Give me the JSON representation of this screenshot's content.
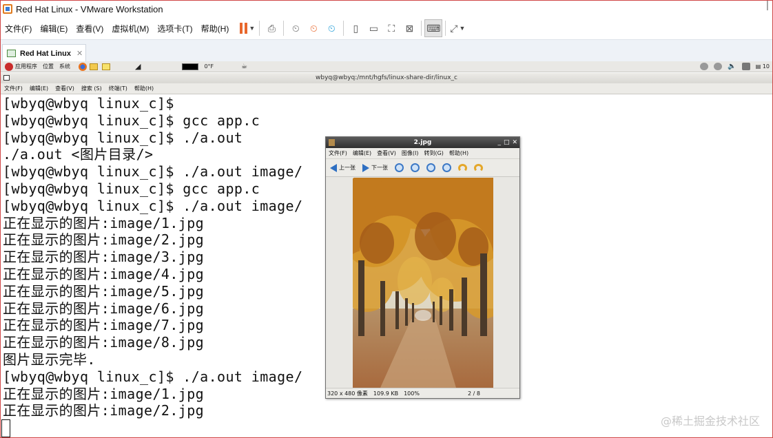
{
  "app": {
    "title": "Red Hat Linux - VMware Workstation",
    "menu": [
      "文件(F)",
      "编辑(E)",
      "查看(V)",
      "虚拟机(M)",
      "选项卡(T)",
      "帮助(H)"
    ],
    "toolbar_icons": [
      "pause-icon",
      "send-keys-icon",
      "snapshot-icon",
      "revert-snapshot-icon",
      "manage-snapshots-icon",
      "library-icon",
      "thumbnail-icon",
      "fit-guest-icon",
      "unity-icon",
      "console-icon",
      "fullscreen-icon"
    ],
    "accent_color": "#e8672c"
  },
  "tab": {
    "label": "Red Hat Linux",
    "close": "✕"
  },
  "guest_panel": {
    "items": [
      "应用程序",
      "位置",
      "系统"
    ],
    "temperature": "0°F",
    "clock": "10"
  },
  "terminal": {
    "title": "wbyq@wbyq:/mnt/hgfs/linux-share-dir/linux_c",
    "menu": [
      "文件(F)",
      "编辑(E)",
      "查看(V)",
      "搜索 (S)",
      "终端(T)",
      "帮助(H)"
    ],
    "lines": [
      "[wbyq@wbyq linux_c]$",
      "[wbyq@wbyq linux_c]$ gcc app.c",
      "[wbyq@wbyq linux_c]$ ./a.out",
      "./a.out <图片目录/>",
      "[wbyq@wbyq linux_c]$ ./a.out image/",
      "[wbyq@wbyq linux_c]$ gcc app.c",
      "[wbyq@wbyq linux_c]$ ./a.out image/",
      "正在显示的图片:image/1.jpg",
      "正在显示的图片:image/2.jpg",
      "正在显示的图片:image/3.jpg",
      "正在显示的图片:image/4.jpg",
      "正在显示的图片:image/5.jpg",
      "正在显示的图片:image/6.jpg",
      "正在显示的图片:image/7.jpg",
      "正在显示的图片:image/8.jpg",
      "图片显示完毕.",
      "[wbyq@wbyq linux_c]$ ./a.out image/",
      "正在显示的图片:image/1.jpg",
      "正在显示的图片:image/2.jpg"
    ]
  },
  "viewer": {
    "title": "2.jpg",
    "menu": [
      "文件(F)",
      "编辑(E)",
      "查看(V)",
      "图像(I)",
      "转到(G)",
      "帮助(H)"
    ],
    "prev_label": "上一张",
    "next_label": "下一张",
    "status": {
      "dimensions": "320 x 480 像素",
      "filesize": "109.9 KB",
      "zoom": "100%",
      "page": "2 / 8"
    }
  },
  "watermark": "@稀土掘金技术社区"
}
